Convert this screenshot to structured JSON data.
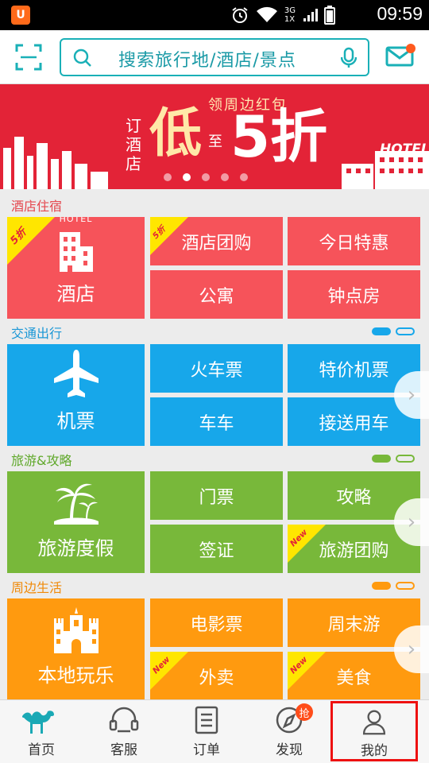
{
  "status_bar": {
    "time": "09:59",
    "network": "3G",
    "network2": "1X"
  },
  "header": {
    "search_placeholder": "搜索旅行地/酒店/景点"
  },
  "banner": {
    "top_text": "领周边红包",
    "side_text": "订酒店",
    "big_text_1": "低",
    "small_text": "至",
    "big_text_2": "5折",
    "sign_text": "HOTEL",
    "dots": 5,
    "active_dot": 1
  },
  "sections": [
    {
      "title": "酒店住宿",
      "color": "#f6535a",
      "title_color": "#e5474e",
      "big": {
        "label": "酒店",
        "icon": "hotel-building-icon",
        "icon_text": "HOTEL",
        "corner": "5折"
      },
      "items": [
        {
          "label": "酒店团购",
          "corner": "5折"
        },
        {
          "label": "今日特惠"
        },
        {
          "label": "公寓"
        },
        {
          "label": "钟点房"
        }
      ]
    },
    {
      "title": "交通出行",
      "color": "#17a7ea",
      "title_color": "#1a97d6",
      "big": {
        "label": "机票",
        "icon": "airplane-icon"
      },
      "items": [
        {
          "label": "火车票"
        },
        {
          "label": "特价机票"
        },
        {
          "label": "车车"
        },
        {
          "label": "接送用车"
        }
      ]
    },
    {
      "title": "旅游&攻略",
      "color": "#78b83a",
      "title_color": "#5fa82a",
      "big": {
        "label": "旅游度假",
        "icon": "palm-island-icon"
      },
      "items": [
        {
          "label": "门票"
        },
        {
          "label": "攻略"
        },
        {
          "label": "签证"
        },
        {
          "label": "旅游团购",
          "corner": "New"
        }
      ]
    },
    {
      "title": "周边生活",
      "color": "#ff9a0f",
      "title_color": "#f08a0a",
      "big": {
        "label": "本地玩乐",
        "icon": "castle-icon"
      },
      "items": [
        {
          "label": "电影票"
        },
        {
          "label": "周末游"
        },
        {
          "label": "外卖",
          "corner": "New"
        },
        {
          "label": "美食",
          "corner": "New"
        }
      ]
    }
  ],
  "tabs": [
    {
      "label": "首页",
      "icon": "camel-icon"
    },
    {
      "label": "客服",
      "icon": "headset-icon"
    },
    {
      "label": "订单",
      "icon": "order-list-icon"
    },
    {
      "label": "发现",
      "icon": "compass-icon",
      "badge": "抢"
    },
    {
      "label": "我的",
      "icon": "person-icon"
    }
  ]
}
